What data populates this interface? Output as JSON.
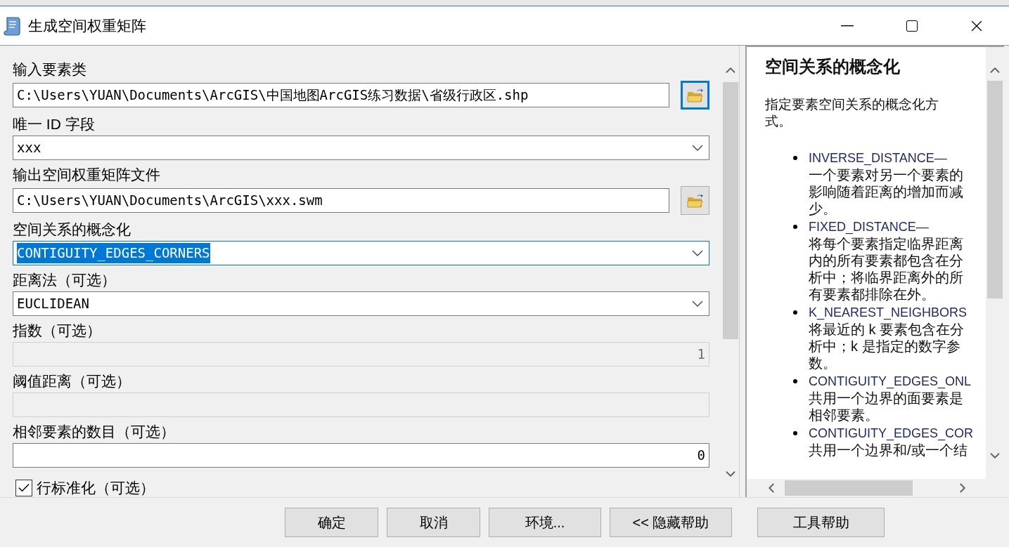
{
  "window": {
    "title": "生成空间权重矩阵"
  },
  "form": {
    "fields": [
      {
        "kind": "file",
        "label": "输入要素类",
        "value": "C:\\Users\\YUAN\\Documents\\ArcGIS\\中国地图ArcGIS练习数据\\省级行政区.shp",
        "disabled": false,
        "highlighted": false,
        "focused": true
      },
      {
        "kind": "dropdown",
        "label": "唯一 ID 字段",
        "value": "xxx",
        "disabled": false,
        "highlighted": false
      },
      {
        "kind": "file",
        "label": "输出空间权重矩阵文件",
        "value": "C:\\Users\\YUAN\\Documents\\ArcGIS\\xxx.swm",
        "disabled": false,
        "highlighted": false,
        "focused": false
      },
      {
        "kind": "dropdown",
        "label": "空间关系的概念化",
        "value": "CONTIGUITY_EDGES_CORNERS",
        "disabled": false,
        "highlighted": true
      },
      {
        "kind": "dropdown",
        "label": "距离法（可选）",
        "value": "EUCLIDEAN",
        "disabled": false,
        "highlighted": false
      },
      {
        "kind": "number",
        "label": "指数（可选）",
        "value": "1",
        "disabled": true,
        "highlighted": false
      },
      {
        "kind": "number",
        "label": "阈值距离（可选）",
        "disabled": true,
        "highlighted": false
      },
      {
        "kind": "number",
        "label": "相邻要素的数目（可选）",
        "value": "0",
        "disabled": false,
        "highlighted": false
      },
      {
        "kind": "checkbox",
        "label": "行标准化（可选）",
        "checked": true
      }
    ]
  },
  "help": {
    "title": "空间关系的概念化",
    "intro": "指定要素空间关系的概念化方式。",
    "items": [
      {
        "term": "INVERSE_DISTANCE—",
        "text": "一个要素对另一个要素的影响随着距离的增加而减少。"
      },
      {
        "term": "FIXED_DISTANCE—",
        "text": "将每个要素指定临界距离内的所有要素都包含在分析中；将临界距离外的所有要素都排除在外。"
      },
      {
        "term": "K_NEAREST_NEIGHBORS",
        "text": "将最近的 k 要素包含在分析中；k 是指定的数字参数。"
      },
      {
        "term": "CONTIGUITY_EDGES_ONL",
        "text": "共用一个边界的面要素是相邻要素。"
      },
      {
        "term": "CONTIGUITY_EDGES_COR",
        "text": "共用一个边界和/或一个结"
      }
    ]
  },
  "buttons": [
    "确定",
    "取消",
    "环境...",
    "<< 隐藏帮助",
    "工具帮助"
  ]
}
